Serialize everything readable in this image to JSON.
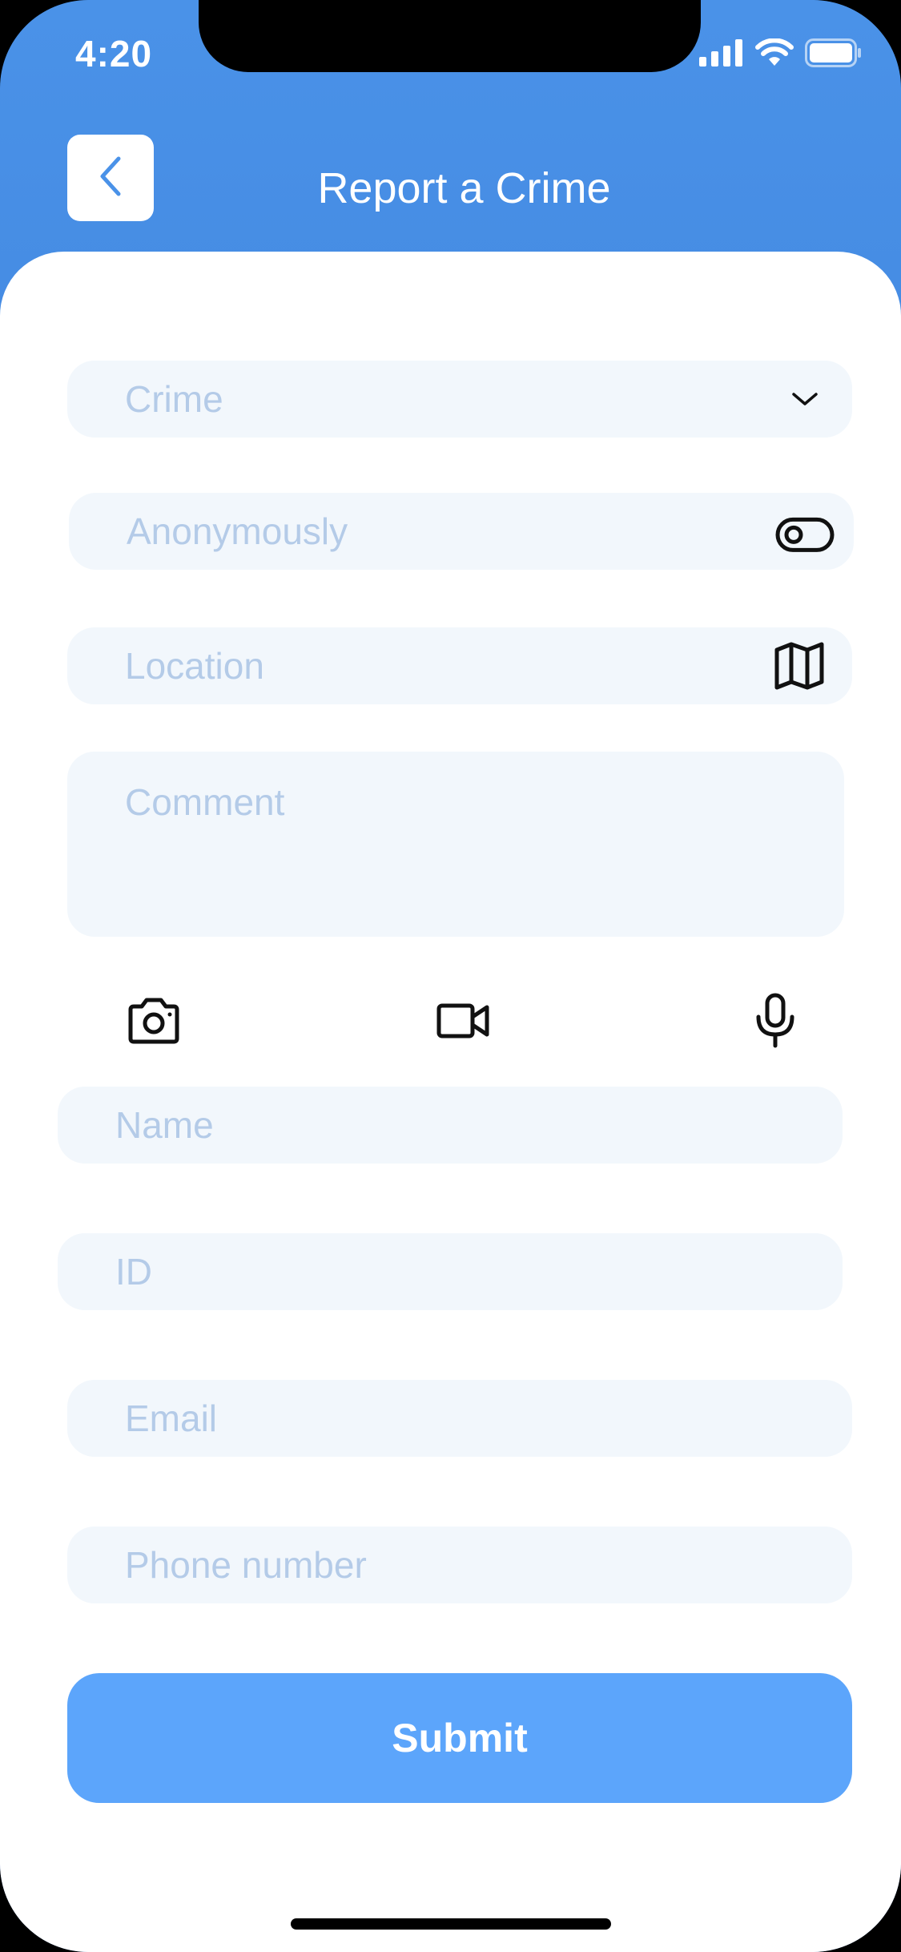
{
  "status_bar": {
    "time": "4:20",
    "icons": [
      "cellular-signal-icon",
      "wifi-icon",
      "battery-icon"
    ]
  },
  "header": {
    "title": "Report a Crime",
    "back_icon": "chevron-left-icon"
  },
  "form": {
    "crime": {
      "placeholder": "Crime",
      "icon": "chevron-down-icon"
    },
    "anonymously": {
      "placeholder": "Anonymously",
      "icon": "toggle-icon",
      "toggle_on": false
    },
    "location": {
      "placeholder": "Location",
      "icon": "map-icon"
    },
    "comment": {
      "placeholder": "Comment"
    },
    "media": {
      "camera_icon": "camera-icon",
      "video_icon": "video-camera-icon",
      "mic_icon": "microphone-icon"
    },
    "name": {
      "placeholder": "Name"
    },
    "id": {
      "placeholder": "ID"
    },
    "email": {
      "placeholder": "Email"
    },
    "phone": {
      "placeholder": "Phone number"
    }
  },
  "submit": {
    "label": "Submit"
  },
  "colors": {
    "header_gradient_top": "#4a92e8",
    "header_gradient_bottom": "#2f6cc4",
    "field_bg": "#f2f7fc",
    "placeholder": "#b4cbe8",
    "accent": "#5ca5fb"
  }
}
